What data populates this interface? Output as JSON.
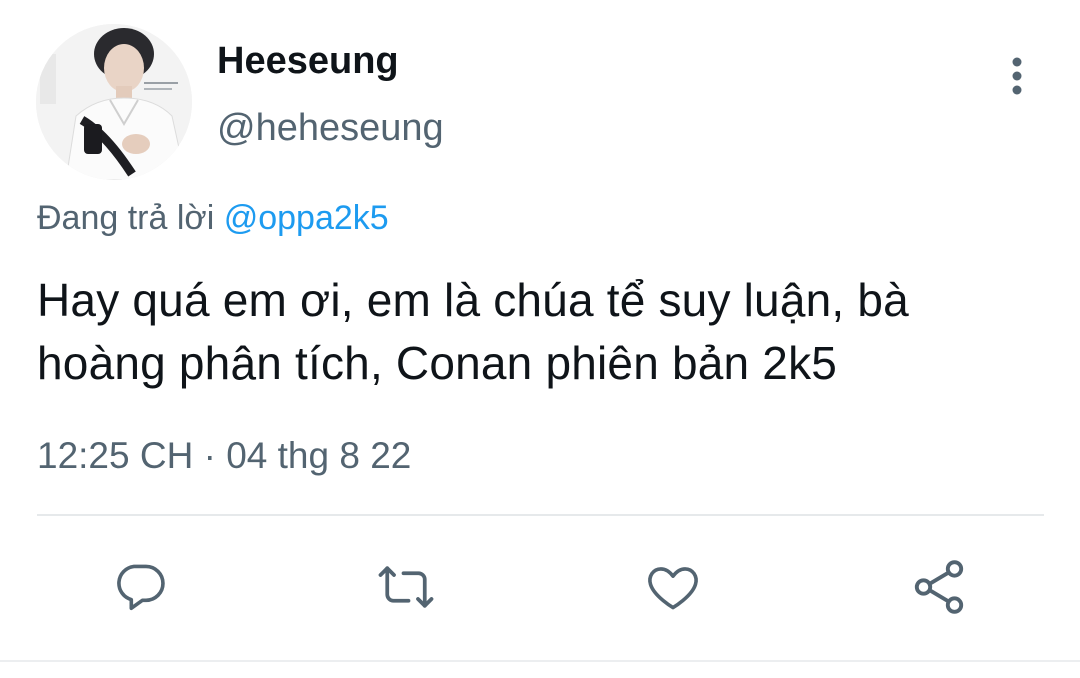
{
  "tweet": {
    "display_name": "Heeseung",
    "handle": "@heheseung",
    "reply_prefix": "Đang trả lời",
    "reply_to": "@oppa2k5",
    "text": "Hay quá em ơi, em là chúa tể suy luận, bà hoàng phân tích, Conan phiên bản 2k5",
    "timestamp": "12:25 CH · 04 thg 8 22"
  },
  "icons": {
    "more": "more-vertical-icon",
    "reply": "reply-icon",
    "retweet": "retweet-icon",
    "like": "heart-icon",
    "share": "share-icon"
  },
  "colors": {
    "text": "#0f1419",
    "secondary": "#536471",
    "mention": "#1d9bf0",
    "divider": "#e6e9eb"
  }
}
